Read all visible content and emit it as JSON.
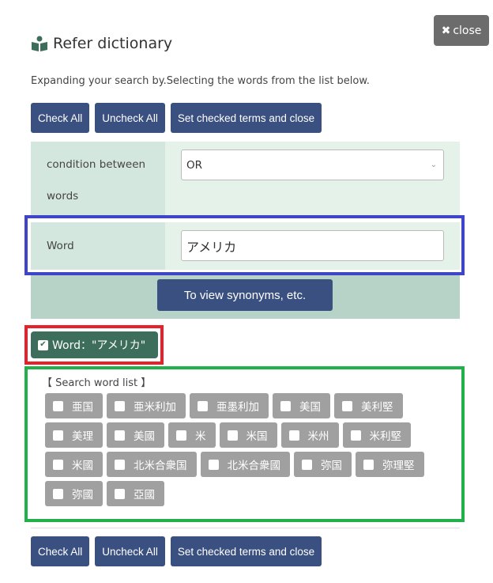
{
  "close_label": "close",
  "title": "Refer dictionary",
  "description": "Expanding your search by.Selecting the words from the list below.",
  "buttons": {
    "check_all": "Check All",
    "uncheck_all": "Uncheck All",
    "set_close": "Set checked terms and close"
  },
  "form": {
    "condition_label": "condition between words",
    "condition_value": "OR",
    "word_label": "Word",
    "word_value": "アメリカ",
    "synonyms_button": "To view synonyms, etc."
  },
  "checked_term": {
    "label": "Word：\"アメリカ\"",
    "checked": true
  },
  "word_list": {
    "heading": "【 Search word list 】",
    "rows": [
      [
        "亜国",
        "亜米利加",
        "亜墨利加",
        "美国",
        "美利堅"
      ],
      [
        "美理",
        "美國",
        "米",
        "米国",
        "米州",
        "米利堅"
      ],
      [
        "米國",
        "北米合衆国",
        "北米合衆國",
        "弥国",
        "弥理堅"
      ],
      [
        "弥國",
        "亞國"
      ]
    ]
  },
  "colors": {
    "primary": "#3a5080",
    "checked_chip": "#3d6e5c",
    "chip": "#a0a0a0"
  }
}
